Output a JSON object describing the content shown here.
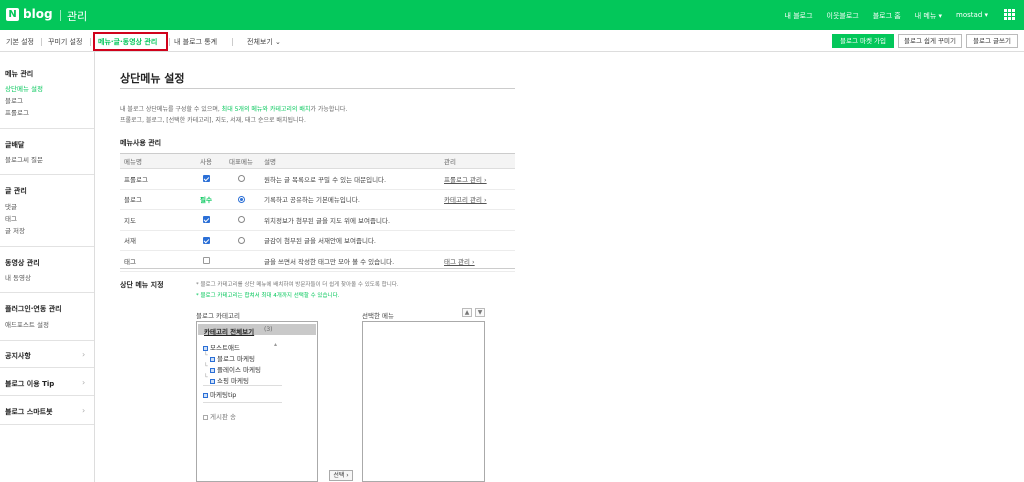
{
  "header": {
    "logo_letter": "N",
    "logo_word": "blog",
    "section": "관리",
    "links": [
      "내 블로그",
      "이웃블로그",
      "블로그 홈",
      "내 메뉴 ▾",
      "mostad ▾"
    ]
  },
  "tabs": [
    {
      "label": "기본 설정"
    },
    {
      "label": "꾸미기 설정"
    },
    {
      "label": "메뉴·글·동영상 관리"
    },
    {
      "label": "내 블로그 통계"
    },
    {
      "label": "전체보기"
    }
  ],
  "actions": {
    "market": "블로그 마켓 가입",
    "decorate": "블로그 쉽게 꾸미기",
    "write": "블로그 글쓰기"
  },
  "sidebar": {
    "menu_head": "메뉴 관리",
    "menu_items": [
      "상단메뉴 설정",
      "블로그",
      "프롤로그"
    ],
    "delivery_head": "글배달",
    "delivery_items": [
      "블로그씨 질문"
    ],
    "post_head": "글 관리",
    "post_items": [
      "댓글",
      "태그",
      "글 저장"
    ],
    "video_head": "동영상 관리",
    "video_items": [
      "내 동영상"
    ],
    "plugin_head": "플러그인·연동 관리",
    "plugin_items": [
      "애드포스트 설정"
    ],
    "notice": "공지사항",
    "tip": "블로그 이용 Tip",
    "smart": "블로그 스마트봇"
  },
  "main": {
    "title": "상단메뉴 설정",
    "desc1_pre": "내 블로그 상단메뉴를 구성할 수 있으며, ",
    "desc1_em": "최대 5개의 메뉴와 카테고리의 배치",
    "desc1_post": "가 가능합니다.",
    "desc2": "프롤로그, 블로그, [선택한 카테고리], 지도, 서재, 태그 순으로 배치됩니다.",
    "usage_title": "메뉴사용 관리",
    "columns": [
      "메뉴명",
      "사용",
      "대표메뉴",
      "설명",
      "관리"
    ],
    "rows": [
      {
        "name": "프롤로그",
        "desc": "원하는 글 목록으로 꾸밀 수 있는 대문입니다.",
        "manage": "프롤로그 관리 ›"
      },
      {
        "name": "블로그",
        "use": "필수",
        "desc": "기록하고 공유하는 기본메뉴입니다.",
        "manage": "카테고리 관리 ›"
      },
      {
        "name": "지도",
        "desc": "위치정보가 첨부된 글을 지도 위에 보여줍니다."
      },
      {
        "name": "서재",
        "desc": "글감이 첨부된 글을 서재안에 보여줍니다."
      },
      {
        "name": "태그",
        "desc": "글을 쓰면서 작성한 태그만 모아 볼 수 있습니다.",
        "manage": "태그 관리 ›"
      }
    ],
    "top_menu_title": "상단 메뉴 지정",
    "note1": "* 블로그 카테고리를 상단 메뉴에 배치하여 방문자들이 더 쉽게 찾아올 수 있도록 합니다.",
    "note2": "* 블로그 카테고리는 합쳐서 최대 4개까지 선택할 수 있습니다.",
    "cat_label": "블로그 카테고리",
    "sel_label": "선택한 메뉴",
    "cat_all": "카테고리 전체보기",
    "cat_count": "(3)",
    "tree": [
      "모스트애드",
      "블로그 마케팅",
      "플레이스 마케팅",
      "쇼핑 마케팅",
      "마케팅tip",
      "게시판 송"
    ],
    "up": "▲",
    "down": "▼",
    "pick": "선택 ›"
  }
}
